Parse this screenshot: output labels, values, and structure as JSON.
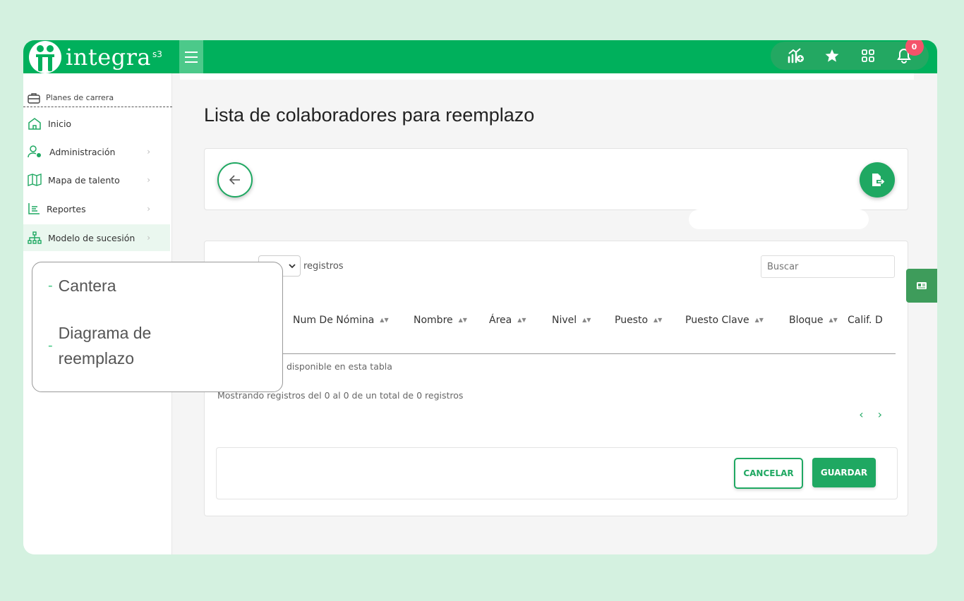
{
  "brand": {
    "name": "integra",
    "suffix": "s3",
    "mark": "®"
  },
  "topbar": {
    "notifications_count": "0",
    "colors": {
      "primary": "#00b05c",
      "accent": "#1fa862",
      "badge": "#f4536a"
    },
    "icons": [
      "growth-chart-icon",
      "star-icon",
      "apps-grid-icon",
      "bell-icon"
    ]
  },
  "sidebar": {
    "header": "Planes de carrera",
    "items": [
      {
        "label": "Inicio",
        "icon": "home-icon"
      },
      {
        "label": "Administración",
        "icon": "user-gear-icon"
      },
      {
        "label": "Mapa de talento",
        "icon": "map-icon"
      },
      {
        "label": "Reportes",
        "icon": "chart-list-icon"
      },
      {
        "label": "Modelo de sucesión",
        "icon": "org-chart-icon"
      }
    ]
  },
  "submenu": {
    "items": [
      {
        "label": "Cantera"
      },
      {
        "label_line1": "Diagrama de",
        "label_line2": "reemplazo"
      }
    ]
  },
  "page": {
    "title": "Lista de colaboradores para reemplazo"
  },
  "table": {
    "length_label": "registros",
    "search_placeholder": "Buscar",
    "columns": [
      "Num De Nómina",
      "Nombre",
      "Área",
      "Nivel",
      "Puesto",
      "Puesto Clave",
      "Bloque",
      "Calif. D"
    ],
    "empty_text": "disponible en esta tabla",
    "info": "Mostrando registros del 0 al 0 de un total de 0 registros",
    "prev": "‹",
    "next": "›"
  },
  "actions": {
    "cancel": "CANCELAR",
    "save": "GUARDAR"
  }
}
